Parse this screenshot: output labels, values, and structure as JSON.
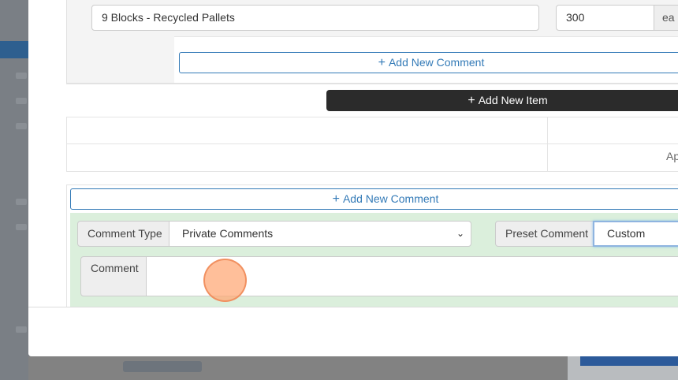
{
  "item": {
    "description": "9 Blocks - Recycled Pallets",
    "quantity": "300",
    "unit": "ea"
  },
  "item_comment": {
    "add_label": "Add New Comment"
  },
  "add_item": {
    "label": "Add New Item"
  },
  "summary": {
    "partial_text": "Ap"
  },
  "comments": {
    "add_label": "Add New Comment",
    "type_label": "Comment Type",
    "type_value": "Private Comments",
    "preset_label": "Preset Comment",
    "preset_value": "Custom",
    "comment_label": "Comment",
    "comment_value": ""
  },
  "icons": {
    "plus": "+",
    "chevron": "⌄"
  },
  "colors": {
    "accent": "#337ab7",
    "dark_button": "#2b2b2b",
    "comment_panel": "#dbefdc"
  }
}
